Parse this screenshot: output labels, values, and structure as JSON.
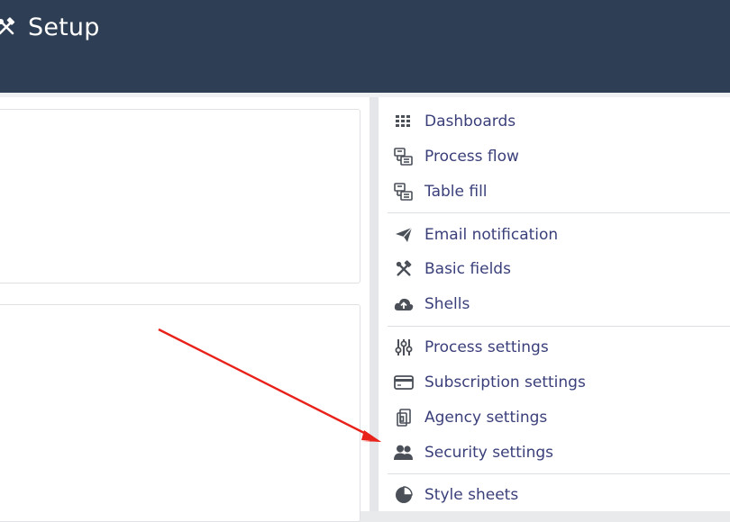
{
  "header": {
    "title": "Setup",
    "icon": "tools-icon"
  },
  "menu": {
    "groups": [
      [
        {
          "label": "Dashboards",
          "icon": "grid-icon"
        },
        {
          "label": "Process flow",
          "icon": "flow-icon"
        },
        {
          "label": "Table fill",
          "icon": "flow-icon"
        }
      ],
      [
        {
          "label": "Email notification",
          "icon": "paper-plane-icon"
        },
        {
          "label": "Basic fields",
          "icon": "tools-icon"
        },
        {
          "label": "Shells",
          "icon": "cloud-upload-icon"
        }
      ],
      [
        {
          "label": "Process settings",
          "icon": "sliders-icon"
        },
        {
          "label": "Subscription settings",
          "icon": "credit-card-icon"
        },
        {
          "label": "Agency settings",
          "icon": "building-icon"
        },
        {
          "label": "Security settings",
          "icon": "users-icon"
        }
      ],
      [
        {
          "label": "Style sheets",
          "icon": "pie-chart-icon"
        }
      ]
    ]
  },
  "colors": {
    "header_bg": "#2e3e54",
    "menu_text": "#3a3f7a",
    "icon": "#4a4f58",
    "arrow": "#e8211a"
  }
}
